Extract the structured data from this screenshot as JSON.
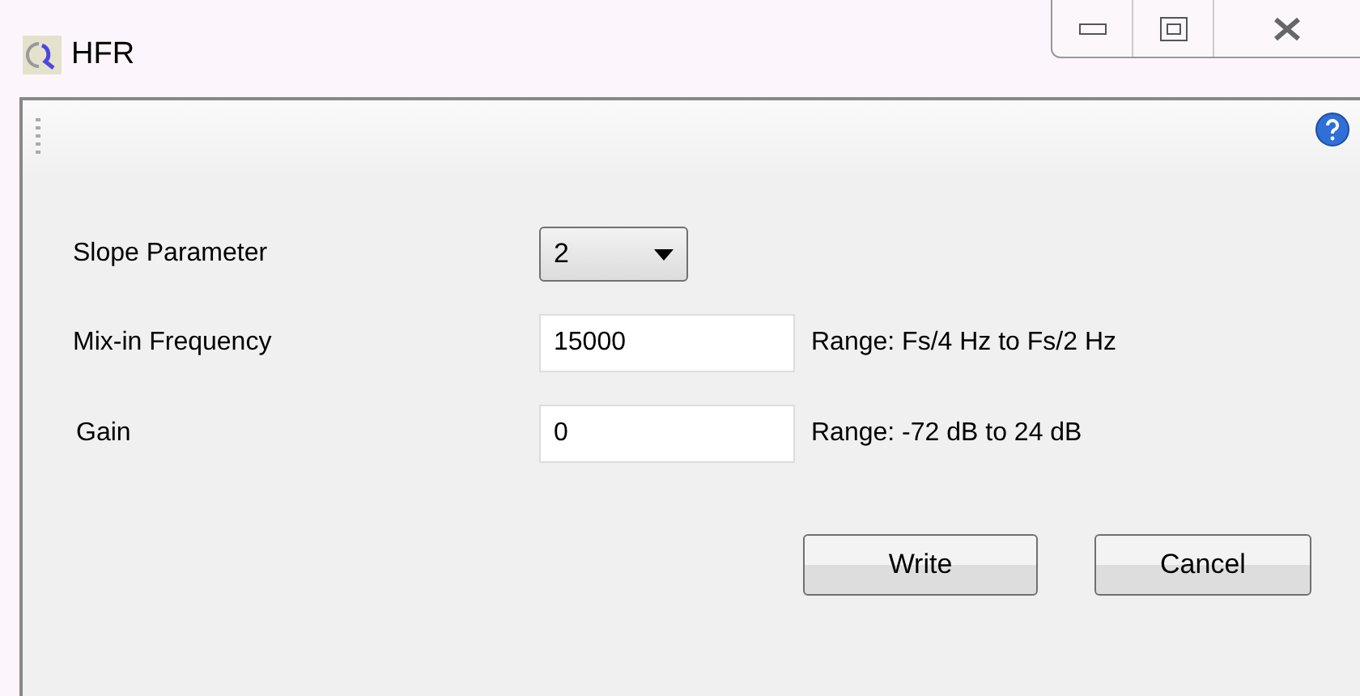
{
  "window": {
    "title": "HFR"
  },
  "fields": [
    {
      "kind": "dropdown",
      "label": "Slope Parameter",
      "value": "2"
    },
    {
      "kind": "text",
      "label": "Mix-in Frequency",
      "value": "15000",
      "hint": "Range: Fs/4 Hz to Fs/2 Hz"
    },
    {
      "kind": "text",
      "label": "Gain",
      "value": "0",
      "hint": "Range: -72 dB to 24 dB"
    }
  ],
  "buttons": [
    "Write",
    "Cancel"
  ]
}
